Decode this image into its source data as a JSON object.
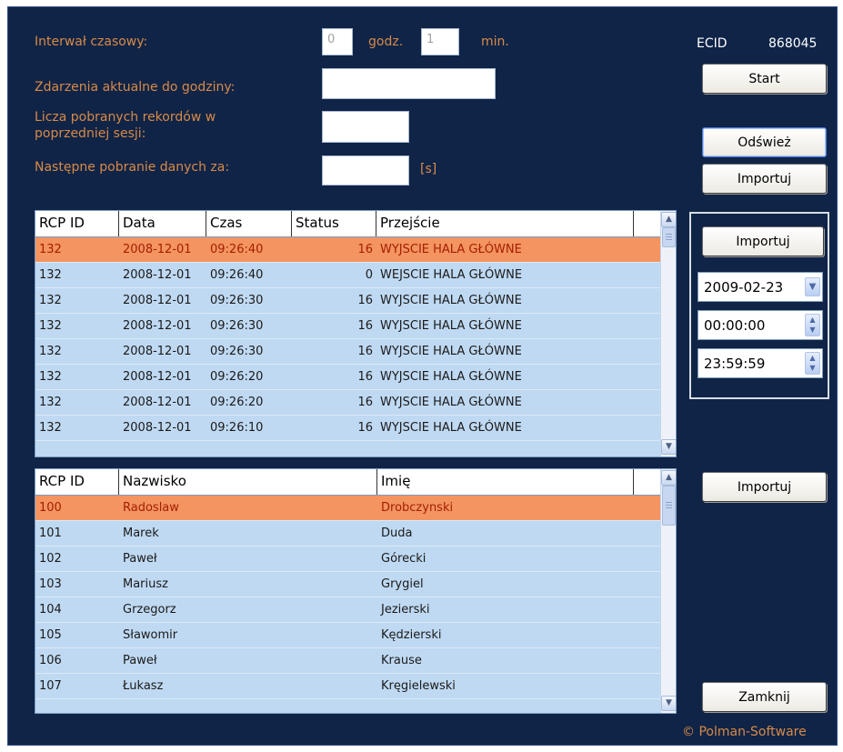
{
  "form": {
    "interval_label": "Interwał czasowy:",
    "interval_hours": "0",
    "hours_unit": "godz.",
    "interval_minutes": "1",
    "minutes_unit": "min.",
    "events_label": "Zdarzenia aktualne do godziny:",
    "events_value": "",
    "records_label_line1": "Licza pobranych rekordów w",
    "records_label_line2": "poprzedniej sesji:",
    "records_value": "",
    "next_label": "Następne pobranie danych za:",
    "next_value": "",
    "seconds_unit": "[s]"
  },
  "ecid": {
    "label": "ECID",
    "value": "868045"
  },
  "buttons": {
    "start": "Start",
    "refresh": "Odśwież",
    "import_top": "Importuj",
    "import_events": "Importuj",
    "import_people": "Importuj",
    "close": "Zamknij"
  },
  "filter": {
    "date": "2009-02-23",
    "time_from": "00:00:00",
    "time_to": "23:59:59"
  },
  "events_grid": {
    "headers": [
      "RCP ID",
      "Data",
      "Czas",
      "Status",
      "Przejście"
    ],
    "rows": [
      [
        "132",
        "2008-12-01",
        "09:26:40",
        "16",
        "WYJSCIE HALA GŁÓWNE"
      ],
      [
        "132",
        "2008-12-01",
        "09:26:40",
        "0",
        "WEJSCIE HALA GŁÓWNE"
      ],
      [
        "132",
        "2008-12-01",
        "09:26:30",
        "16",
        "WYJSCIE HALA GŁÓWNE"
      ],
      [
        "132",
        "2008-12-01",
        "09:26:30",
        "16",
        "WYJSCIE HALA GŁÓWNE"
      ],
      [
        "132",
        "2008-12-01",
        "09:26:30",
        "16",
        "WYJSCIE HALA GŁÓWNE"
      ],
      [
        "132",
        "2008-12-01",
        "09:26:20",
        "16",
        "WYJSCIE HALA GŁÓWNE"
      ],
      [
        "132",
        "2008-12-01",
        "09:26:20",
        "16",
        "WYJSCIE HALA GŁÓWNE"
      ],
      [
        "132",
        "2008-12-01",
        "09:26:10",
        "16",
        "WYJSCIE HALA GŁÓWNE"
      ]
    ]
  },
  "people_grid": {
    "headers": [
      "RCP ID",
      "Nazwisko",
      "Imię"
    ],
    "rows": [
      [
        "100",
        "Radoslaw",
        "Drobczynski"
      ],
      [
        "101",
        "Marek",
        "Duda"
      ],
      [
        "102",
        "Paweł",
        "Górecki"
      ],
      [
        "103",
        "Mariusz",
        "Grygiel"
      ],
      [
        "104",
        "Grzegorz",
        "Jezierski"
      ],
      [
        "105",
        "Sławomir",
        "Kędzierski"
      ],
      [
        "106",
        "Paweł",
        "Krause"
      ],
      [
        "107",
        "Łukasz",
        "Kręgielewski"
      ]
    ]
  },
  "copyright": "© Polman-Software"
}
